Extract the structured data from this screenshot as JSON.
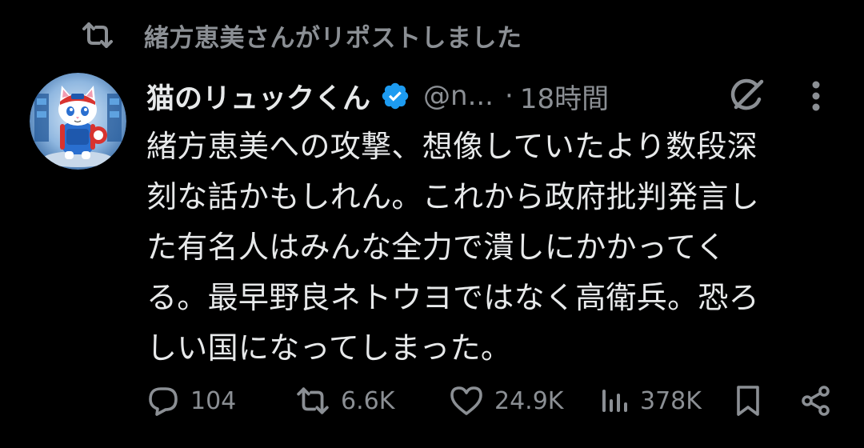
{
  "repost_banner": {
    "text": "緒方恵美さんがリポストしました",
    "icon": "repost-icon"
  },
  "tweet": {
    "author": {
      "display_name": "猫のリュックくん",
      "handle": "@n...",
      "verified_icon": "verified-badge-icon",
      "avatar": "cat-avatar"
    },
    "separator": "·",
    "time": "18時間",
    "text": "緒方恵美への攻撃、想像していたより数段深\n刻な話かもしれん。これから政府批判発言し\nた有名人はみんな全力で潰しにかかってく\nる。最早野良ネトウヨではなく高衛兵。恐ろ\nしい国になってしまった。",
    "actions": {
      "reply": {
        "icon": "reply-icon",
        "count": "104"
      },
      "repost": {
        "icon": "repost-icon",
        "count": "6.6K"
      },
      "like": {
        "icon": "heart-icon",
        "count": "24.9K"
      },
      "views": {
        "icon": "analytics-icon",
        "count": "378K"
      },
      "bookmark": {
        "icon": "bookmark-icon"
      },
      "share": {
        "icon": "share-icon"
      }
    },
    "header_icons": {
      "grok": "grok-icon",
      "more": "more-dots-icon"
    }
  },
  "colors": {
    "background": "#000000",
    "text_primary": "#e7e9ea",
    "text_secondary": "#8b8f94",
    "verified_blue": "#1d9bf0"
  }
}
